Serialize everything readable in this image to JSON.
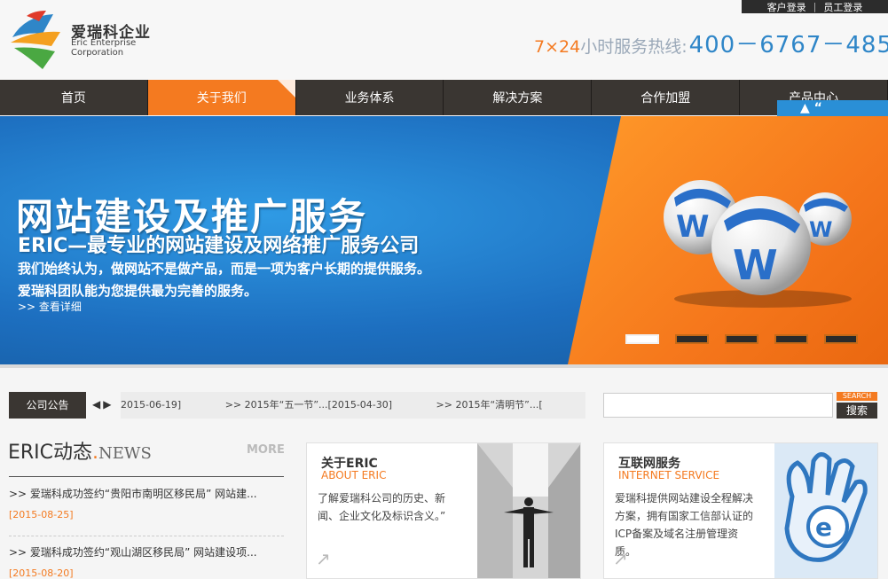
{
  "header": {
    "logo_cn": "爱瑞科企业",
    "logo_en_line1": "Eric Enterprise",
    "logo_en_line2": "Corporation",
    "top_links": [
      "客户登录",
      "员工登录"
    ],
    "hotline_prefix": "7×24",
    "hotline_label": "小时服务热线:",
    "hotline_number": "400－6767－485"
  },
  "nav": {
    "items": [
      "首页",
      "关于我们",
      "业务体系",
      "解决方案",
      "合作加盟",
      "产品中心"
    ],
    "active_index": 1
  },
  "banner": {
    "title": "网站建设及推广服务",
    "subtitle": "ERIC—最专业的网站建设及网络推广服务公司",
    "line1": "我们始终认为，做网站不是做产品，而是一项为客户长期的提供服务。",
    "line2": "爱瑞科团队能为您提供最为完善的服务。",
    "more_link": ">> 查看详细",
    "slide_count": 5,
    "active_slide": 0
  },
  "notice": {
    "label": "公司公告",
    "items": [
      "2015-06-19]",
      ">> 2015年“五一节”...[2015-04-30]",
      ">> 2015年“清明节”...["
    ]
  },
  "search": {
    "tag": "SEARCH",
    "button": "搜索",
    "value": ""
  },
  "news": {
    "title_cn": "ERIC动态",
    "title_dot": ".",
    "title_en": "NEWS",
    "more": "MORE",
    "items": [
      {
        "title": ">> 爱瑞科成功签约“贵阳市南明区移民局” 网站建...",
        "date": "[2015-08-25]"
      },
      {
        "title": ">> 爱瑞科成功签约“观山湖区移民局” 网站建设项...",
        "date": "[2015-08-20]"
      }
    ]
  },
  "cards": [
    {
      "title": "关于ERIC",
      "title_en": "ABOUT ERIC",
      "desc": [
        "了解爱瑞科公司的历史、新",
        "闻、企业文化及标识含义。”"
      ]
    },
    {
      "title": "互联网服务",
      "title_en": "INTERNET SERVICE",
      "desc": [
        "爱瑞科提供网站建设全程解决",
        "方案，拥有国家工信部认证的",
        "ICP备案及域名注册管理资",
        "质。"
      ]
    }
  ],
  "colors": {
    "accent": "#f47a20",
    "nav_bg": "#3a3632",
    "blue": "#2f86c8"
  }
}
